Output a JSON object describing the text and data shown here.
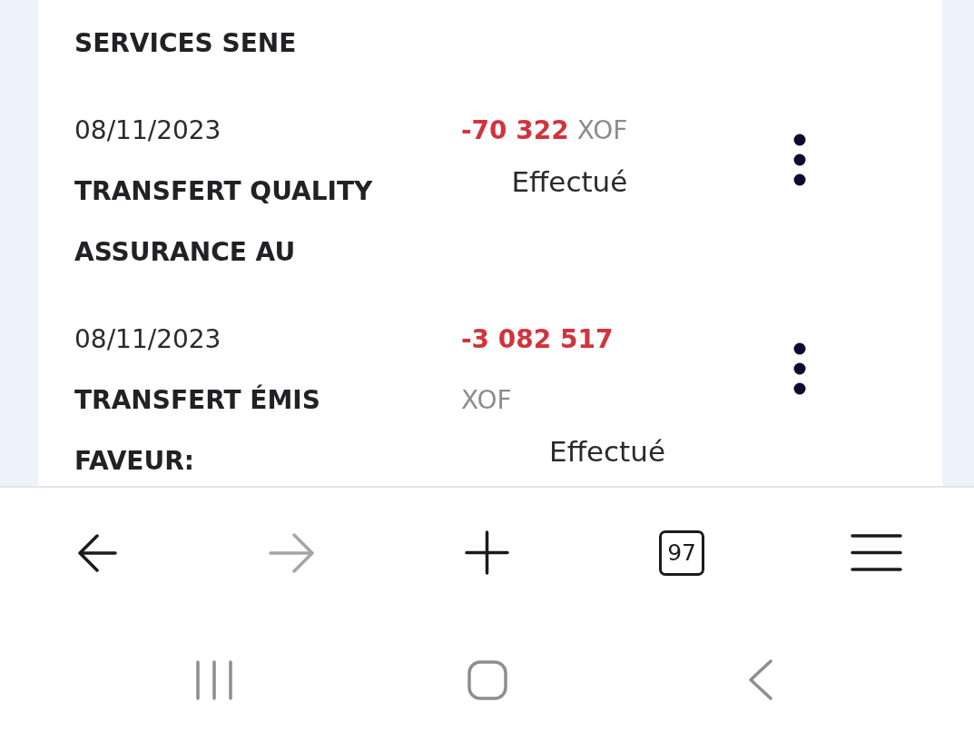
{
  "card": {
    "top_line": "SERVICES SENE",
    "transactions": [
      {
        "date": "08/11/2023",
        "title": "TRANSFERT QUALITY ASSURANCE AU",
        "amount": "-70 322",
        "currency": "XOF",
        "status": "Effectué"
      },
      {
        "date": "08/11/2023",
        "title": "TRANSFERT ÉMIS FAVEUR:",
        "amount": "-3 082 517",
        "currency": "XOF",
        "status": "Effectué"
      }
    ]
  },
  "browser_toolbar": {
    "buttons": [
      {
        "kind": "back",
        "disabled": false
      },
      {
        "kind": "forward",
        "disabled": true
      },
      {
        "kind": "new-tab",
        "disabled": false
      },
      {
        "kind": "tabs",
        "label": "97",
        "disabled": false
      },
      {
        "kind": "menu",
        "disabled": false
      }
    ]
  },
  "navigation_bar": {
    "buttons": [
      {
        "kind": "recents"
      },
      {
        "kind": "home"
      },
      {
        "kind": "back"
      }
    ]
  }
}
